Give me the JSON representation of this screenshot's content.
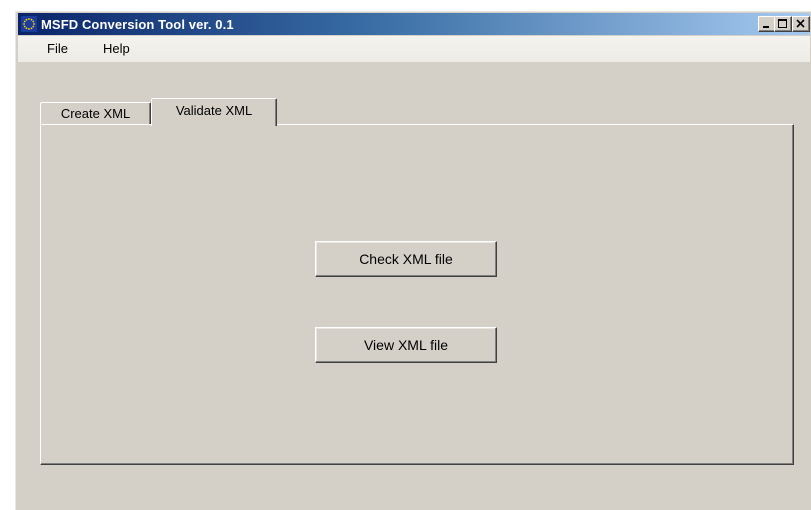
{
  "window": {
    "title": "MSFD Conversion Tool ver. 0.1",
    "icon": "eu-flag-icon"
  },
  "caption_buttons": {
    "minimize": "minimize-icon",
    "maximize": "maximize-icon",
    "close": "close-icon"
  },
  "menu": {
    "items": [
      {
        "label": "File"
      },
      {
        "label": "Help"
      }
    ]
  },
  "tabs": [
    {
      "label": "Create XML",
      "selected": false
    },
    {
      "label": "Validate XML",
      "selected": true
    }
  ],
  "panel": {
    "buttons": [
      {
        "label": "Check XML file"
      },
      {
        "label": "View XML file"
      }
    ]
  },
  "colors": {
    "titlebar_start": "#0a246a",
    "titlebar_end": "#a6caf0",
    "face": "#d4d0c8"
  }
}
